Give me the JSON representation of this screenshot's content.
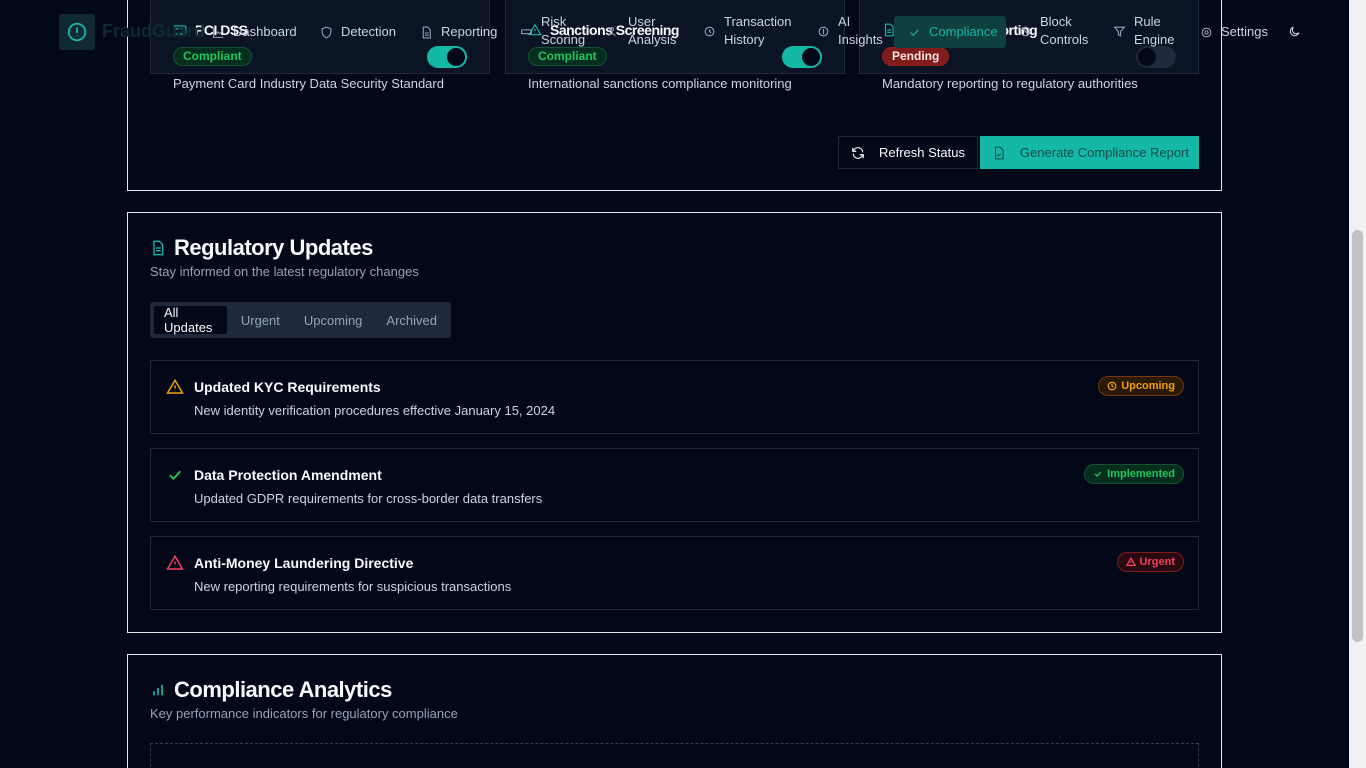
{
  "header": {
    "brand": "FraudGuard",
    "nav": [
      {
        "label": "Dashboard",
        "icon": "dashboard-icon"
      },
      {
        "label": "Detection",
        "icon": "shield-icon"
      },
      {
        "label": "Reporting",
        "icon": "document-icon"
      },
      {
        "label": "Risk Scoring",
        "icon": "gauge-icon"
      },
      {
        "label": "User Analysis",
        "icon": "users-icon"
      },
      {
        "label": "Transaction History",
        "icon": "history-icon"
      },
      {
        "label": "AI Insights",
        "icon": "ai-icon"
      },
      {
        "label": "Compliance",
        "icon": "check-icon"
      },
      {
        "label": "Block Controls",
        "icon": "block-icon"
      },
      {
        "label": "Rule Engine",
        "icon": "filter-icon"
      },
      {
        "label": "Settings",
        "icon": "gear-icon"
      }
    ]
  },
  "compliance": {
    "standards": [
      {
        "title": "PCI DSS",
        "status": "Compliant",
        "enabled": true,
        "description": "Payment Card Industry Data Security Standard",
        "icon": "card-icon"
      },
      {
        "title": "Sanctions Screening",
        "status": "Compliant",
        "enabled": true,
        "description": "International sanctions compliance monitoring",
        "icon": "warning-icon"
      },
      {
        "title": "Regulatory Reporting",
        "status": "Pending",
        "enabled": false,
        "description": "Mandatory reporting to regulatory authorities",
        "icon": "document-icon"
      }
    ],
    "refresh_label": "Refresh Status",
    "generate_label": "Generate Compliance Report"
  },
  "updates": {
    "title": "Regulatory Updates",
    "subtitle": "Stay informed on the latest regulatory changes",
    "tabs": [
      "All Updates",
      "Urgent",
      "Upcoming",
      "Archived"
    ],
    "active_tab": "All Updates",
    "items": [
      {
        "title": "Updated KYC Requirements",
        "description": "New identity verification procedures effective January 15, 2024",
        "badge": "Upcoming",
        "icon": "warning-icon",
        "color": "#f59e0b"
      },
      {
        "title": "Data Protection Amendment",
        "description": "Updated GDPR requirements for cross-border data transfers",
        "badge": "Implemented",
        "icon": "check-icon",
        "color": "#22c55e"
      },
      {
        "title": "Anti-Money Laundering Directive",
        "description": "New reporting requirements for suspicious transactions",
        "badge": "Urgent",
        "icon": "alert-triangle-icon",
        "color": "#f43f5e"
      }
    ]
  },
  "analytics": {
    "title": "Compliance Analytics",
    "subtitle": "Key performance indicators for regulatory compliance"
  },
  "colors": {
    "accent": "#14b8a6",
    "background": "#020817",
    "success": "#22c55e",
    "warning": "#f59e0b",
    "danger": "#f43f5e"
  }
}
